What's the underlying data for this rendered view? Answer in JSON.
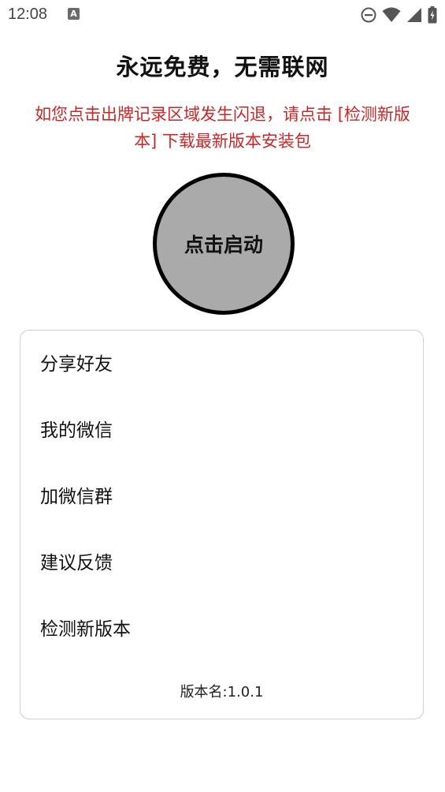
{
  "status_bar": {
    "time": "12:08",
    "notification_icon": "A",
    "icons": [
      "do-not-disturb-icon",
      "wifi-icon",
      "signal-icon",
      "battery-icon"
    ]
  },
  "header": {
    "title": "永远免费，无需联网",
    "warning": "如您点击出牌记录区域发生闪退，请点击 [检测新版本] 下载最新版本安装包",
    "warning_color": "#c62828"
  },
  "start_button": {
    "label": "点击启动",
    "fill_color": "#aaaaaa",
    "border_color": "#000000"
  },
  "menu": {
    "items": [
      {
        "label": "分享好友"
      },
      {
        "label": "我的微信"
      },
      {
        "label": "加微信群"
      },
      {
        "label": "建议反馈"
      },
      {
        "label": "检测新版本"
      }
    ],
    "version": "版本名:1.0.1"
  }
}
